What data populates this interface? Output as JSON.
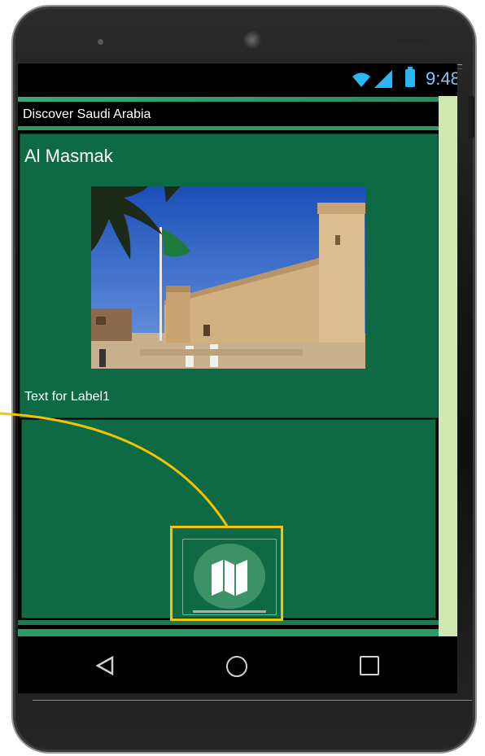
{
  "status_bar": {
    "time": "9:48",
    "icons": [
      "wifi-icon",
      "signal-icon",
      "battery-icon"
    ]
  },
  "app": {
    "title": "Discover Saudi Arabia"
  },
  "card": {
    "heading": "Al Masmak",
    "label1": "Text for Label1",
    "image": "Al Masmak fortress photo"
  },
  "panel": {
    "map_button_icon": "map-icon"
  },
  "navigation": {
    "buttons": [
      "back-icon",
      "home-icon",
      "recent-apps-icon"
    ]
  },
  "colors": {
    "screen_green": "#0e6a44",
    "accent_green": "#2a9a68",
    "side_strip": "#cfe8b0",
    "highlight": "#f5c400",
    "map_button": "#3c9266"
  }
}
